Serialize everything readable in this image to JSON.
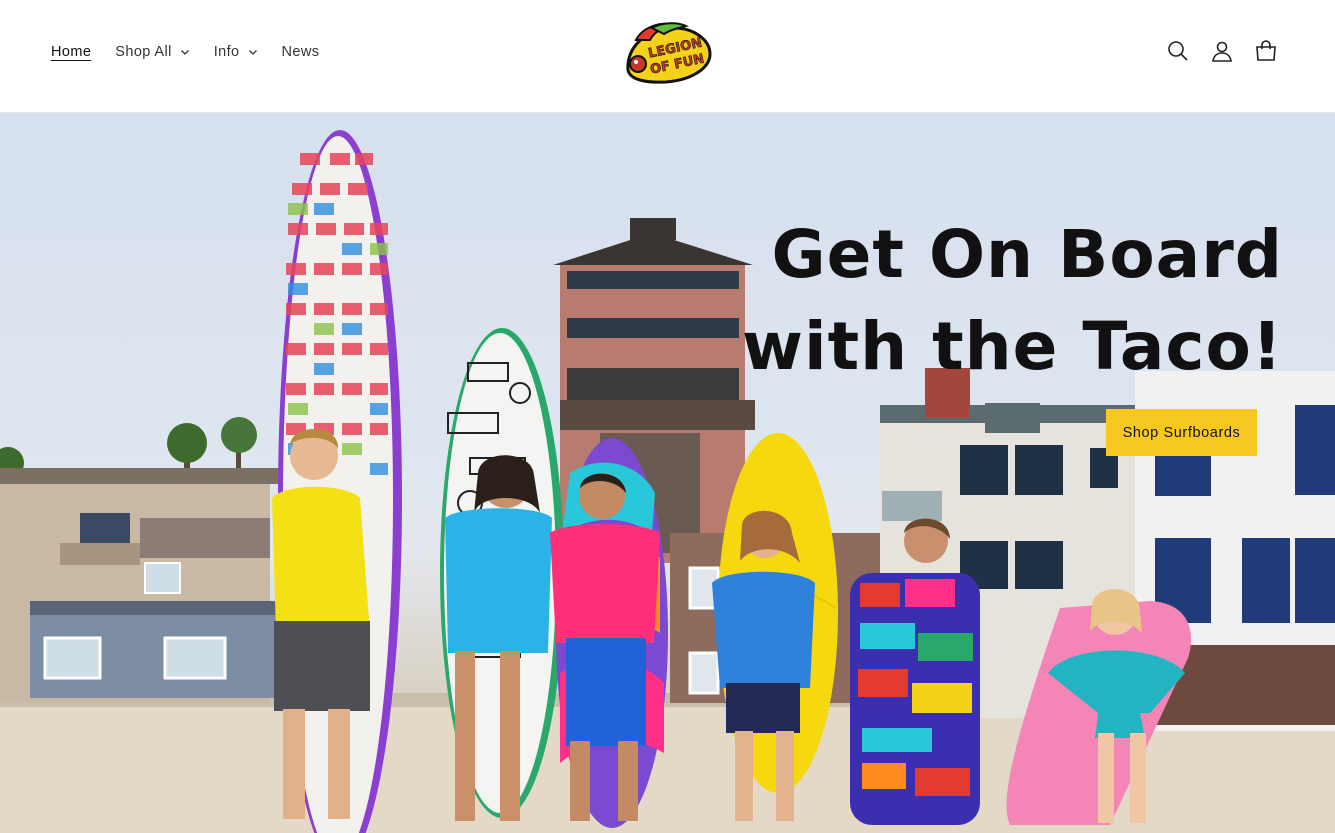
{
  "nav": {
    "items": [
      {
        "label": "Home",
        "active": true,
        "dropdown": false
      },
      {
        "label": "Shop All",
        "active": false,
        "dropdown": true
      },
      {
        "label": "Info",
        "active": false,
        "dropdown": true
      },
      {
        "label": "News",
        "active": false,
        "dropdown": false
      }
    ]
  },
  "logo": {
    "line1": "LEGION",
    "line2": "OF FUN"
  },
  "icons": [
    "search-icon",
    "account-icon",
    "cart-icon"
  ],
  "hero": {
    "heading_line1": "Get On Board",
    "heading_line2": "with the Taco!",
    "button_label": "Shop Surfboards"
  },
  "colors": {
    "accent": "#f7c81f",
    "text": "#121212",
    "background": "#ffffff"
  }
}
